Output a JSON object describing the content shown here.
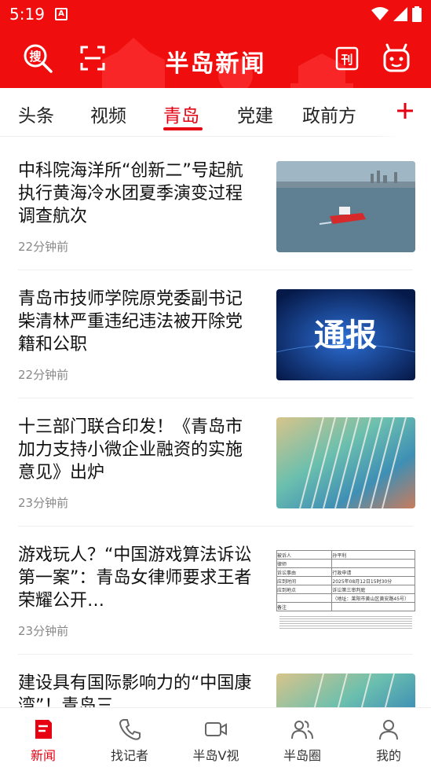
{
  "status_bar": {
    "time": "5:19",
    "notification_letter": "A"
  },
  "header": {
    "logo_text": "半岛新闻"
  },
  "tabs": [
    {
      "label": "头条",
      "active": false
    },
    {
      "label": "视频",
      "active": false
    },
    {
      "label": "青岛",
      "active": true
    },
    {
      "label": "党建",
      "active": false
    },
    {
      "label": "政前方",
      "active": false
    }
  ],
  "articles": [
    {
      "title": "中科院海洋所“创新二”号起航执行黄海冷水团夏季演变过程调查航次",
      "time": "22分钟前",
      "thumb": "ship-photo"
    },
    {
      "title": "青岛市技师学院原党委副书记柴清林严重违纪违法被开除党籍和公职",
      "time": "22分钟前",
      "thumb": "notice-banner",
      "thumb_text": "通报"
    },
    {
      "title": "十三部门联合印发！《青岛市加力支持小微企业融资的实施意见》出炉",
      "time": "23分钟前",
      "thumb": "documents-photo"
    },
    {
      "title": "游戏玩人？“中国游戏算法诉讼第一案”：青岛女律师要求王者荣耀公开…",
      "time": "23分钟前",
      "thumb": "court-document"
    },
    {
      "title": "建设具有国际影响力的“中国康湾”！青岛三",
      "time": "",
      "thumb": "documents-photo"
    }
  ],
  "court_doc": {
    "rows": [
      [
        "被诉人",
        "孙平利"
      ],
      [
        "律师",
        ""
      ],
      [
        "诉讼事由",
        "行政申请"
      ],
      [
        "应到时间",
        "2025年08月12日15时30分"
      ],
      [
        "应到地点",
        "诉讼第三审判庭"
      ],
      [
        "",
        "（地址：莱阳市黄山区黄安路45号）"
      ],
      [
        "备注",
        ""
      ]
    ]
  },
  "bottom_nav": [
    {
      "label": "新闻",
      "icon": "news-icon",
      "active": true
    },
    {
      "label": "找记者",
      "icon": "phone-icon",
      "active": false
    },
    {
      "label": "半岛V视",
      "icon": "video-camera-icon",
      "active": false
    },
    {
      "label": "半岛圈",
      "icon": "community-icon",
      "active": false
    },
    {
      "label": "我的",
      "icon": "profile-icon",
      "active": false
    }
  ],
  "colors": {
    "brand_red": "#f00d0d",
    "accent_red": "#e60012",
    "muted": "#888888"
  }
}
